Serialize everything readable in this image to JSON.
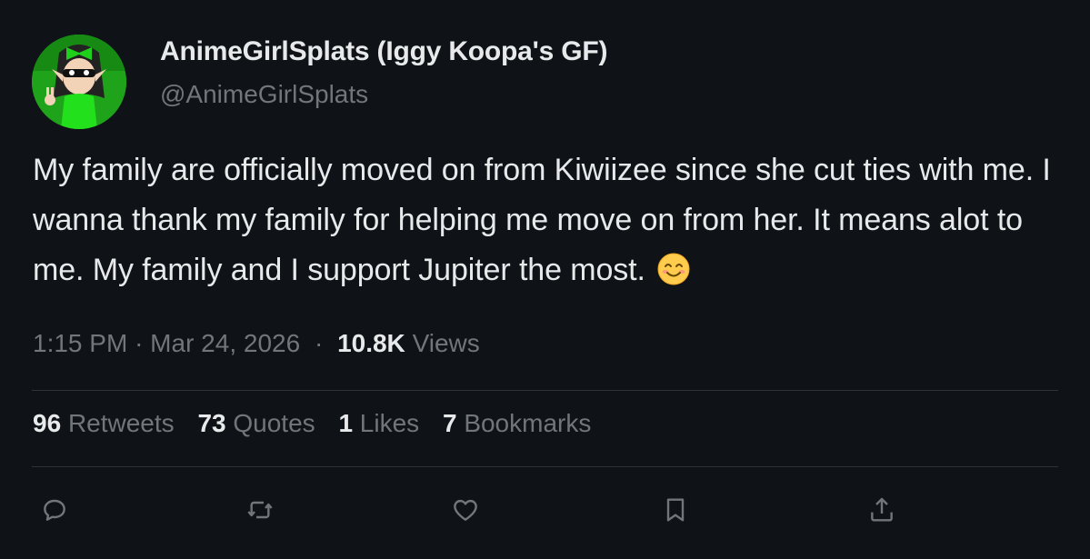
{
  "author": {
    "display_name": "AnimeGirlSplats (Iggy Koopa's GF)",
    "handle": "@AnimeGirlSplats",
    "avatar_icon": "avatar-image",
    "avatar_bg": "#1fa31a"
  },
  "tweet": {
    "text": "My family are officially moved on from Kiwiizee since she cut ties with me. I wanna thank my family for helping me move on from her. It means alot to me. My family and I support Jupiter the most.",
    "emoji": "smiling-face-emoji",
    "time": "1:15 PM",
    "date": "Mar 24, 2026",
    "views_count": "10.8K",
    "views_label": "Views"
  },
  "stats": {
    "retweets_count": "96",
    "retweets_label": "Retweets",
    "quotes_count": "73",
    "quotes_label": "Quotes",
    "likes_count": "1",
    "likes_label": "Likes",
    "bookmarks_count": "7",
    "bookmarks_label": "Bookmarks"
  },
  "actions": [
    {
      "name": "reply-icon"
    },
    {
      "name": "retweet-icon"
    },
    {
      "name": "like-icon"
    },
    {
      "name": "bookmark-icon"
    },
    {
      "name": "share-icon"
    }
  ],
  "colors": {
    "background": "#0f1317",
    "text_primary": "#e7e9ea",
    "text_secondary": "#71767b",
    "divider": "#2f3336"
  }
}
